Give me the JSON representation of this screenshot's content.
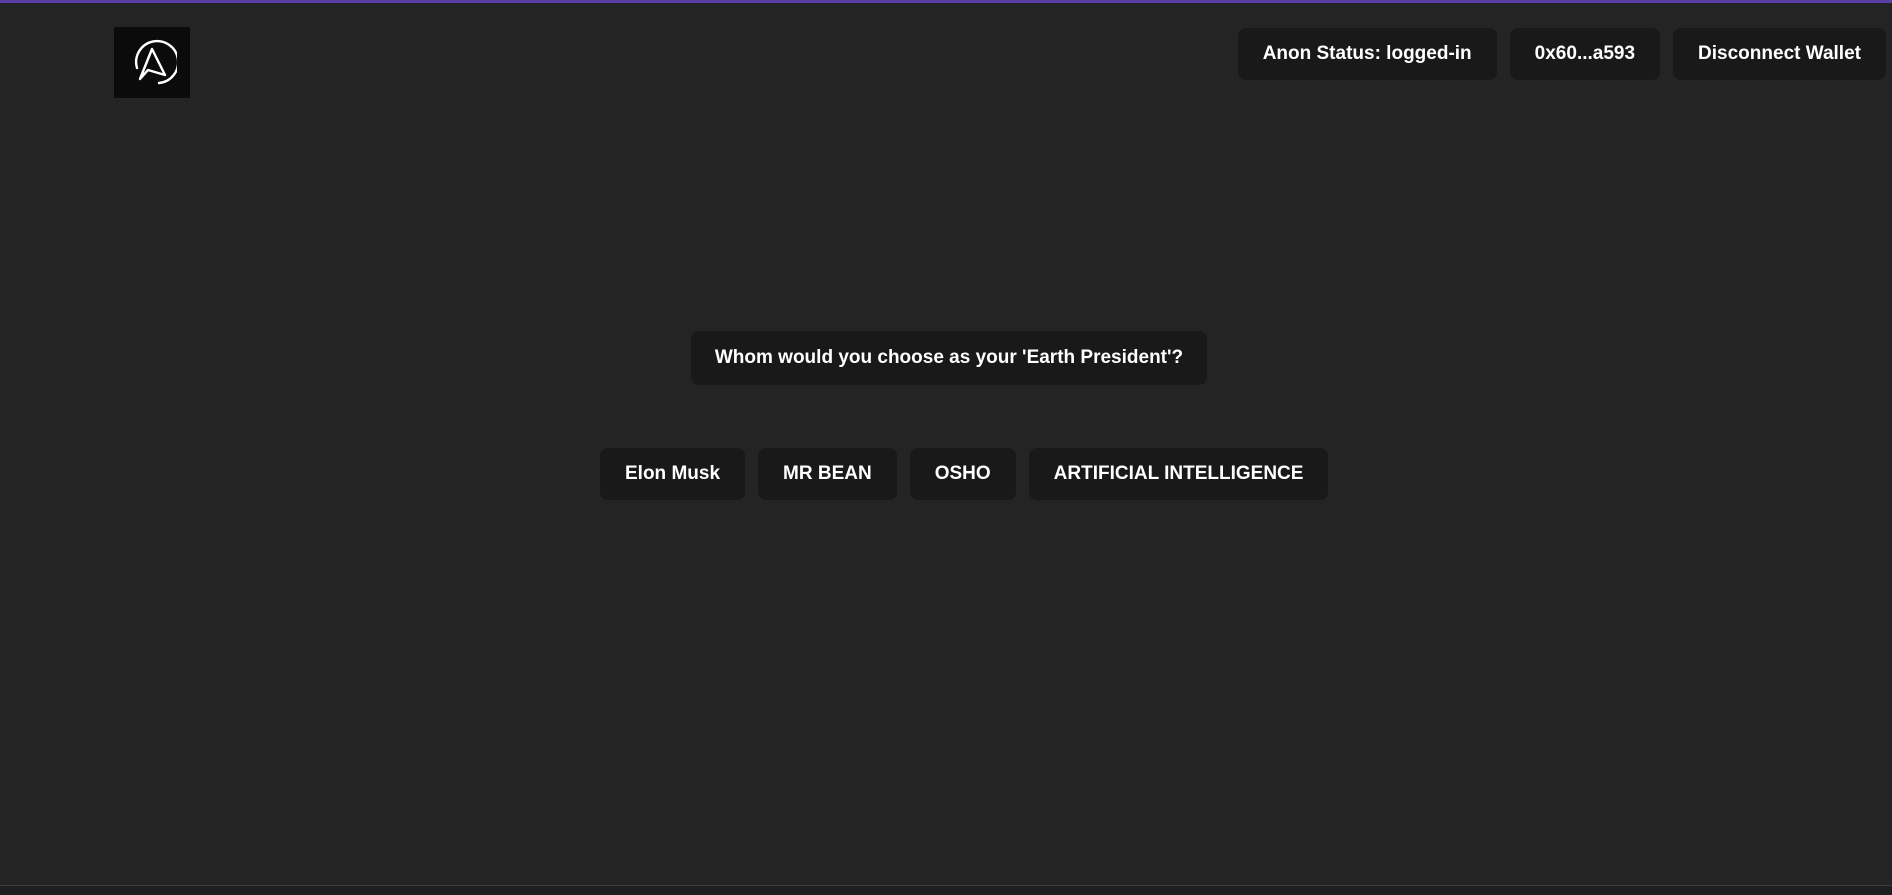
{
  "header": {
    "logo_icon": "anon-logo-icon",
    "anon_status": "Anon Status: logged-in",
    "wallet_address": "0x60...a593",
    "disconnect_label": "Disconnect Wallet"
  },
  "poll": {
    "question": "Whom would you choose as your 'Earth President'?",
    "options": [
      {
        "label": "Elon Musk"
      },
      {
        "label": "MR BEAN"
      },
      {
        "label": "OSHO"
      },
      {
        "label": "ARTIFICIAL INTELLIGENCE"
      }
    ]
  },
  "colors": {
    "background": "#242424",
    "surface": "#191919",
    "accent": "#5b3fa6",
    "text": "#ffffff"
  }
}
